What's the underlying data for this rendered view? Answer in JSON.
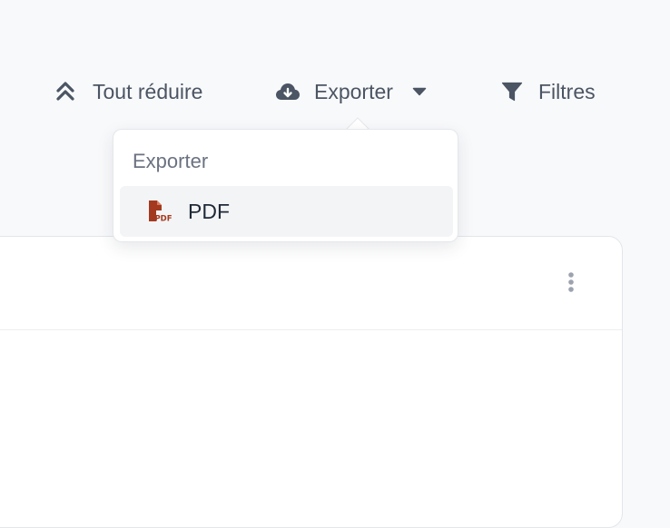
{
  "toolbar": {
    "collapse_all_label": "Tout réduire",
    "export_label": "Exporter",
    "filters_label": "Filtres"
  },
  "export_menu": {
    "heading": "Exporter",
    "items": [
      {
        "label": "PDF",
        "icon": "file-pdf-icon"
      }
    ]
  },
  "colors": {
    "toolbar_text": "#4b5563",
    "pdf_icon": "#a33a1f",
    "page_background": "#f8f9fb"
  }
}
